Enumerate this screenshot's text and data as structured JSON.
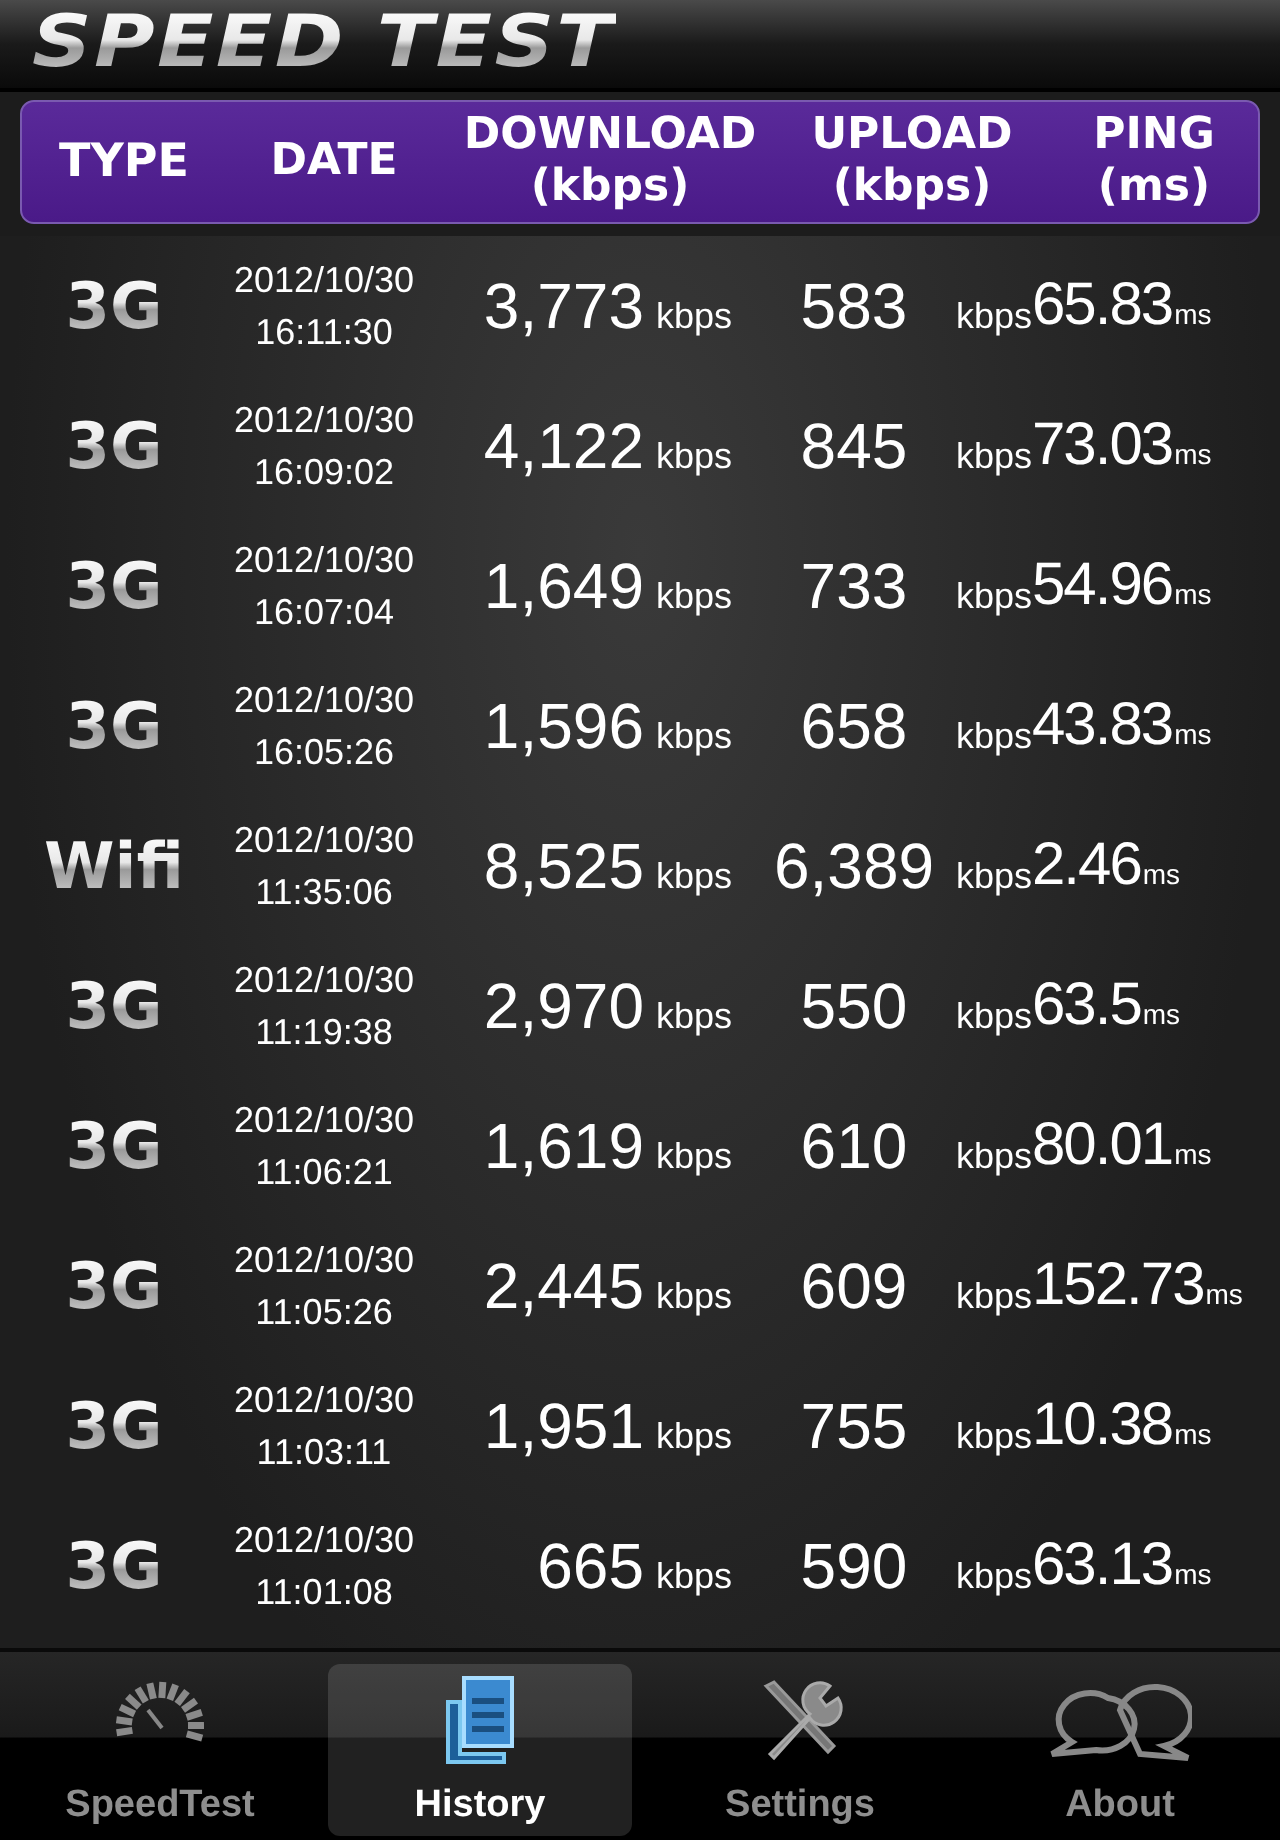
{
  "app": {
    "title": "SPEED TEST"
  },
  "columns": [
    {
      "label": "TYPE"
    },
    {
      "label": "DATE"
    },
    {
      "label": "DOWNLOAD",
      "unit": "(kbps)"
    },
    {
      "label": "UPLOAD",
      "unit": "(kbps)"
    },
    {
      "label": "PING",
      "unit": "(ms)"
    }
  ],
  "rows": [
    {
      "type": "3G",
      "date": "2012/10/30",
      "time": "16:11:30",
      "download": "3,773",
      "download_unit": "kbps",
      "upload": "583",
      "upload_unit": "kbps",
      "ping": "65.83",
      "ping_unit": "ms"
    },
    {
      "type": "3G",
      "date": "2012/10/30",
      "time": "16:09:02",
      "download": "4,122",
      "download_unit": "kbps",
      "upload": "845",
      "upload_unit": "kbps",
      "ping": "73.03",
      "ping_unit": "ms"
    },
    {
      "type": "3G",
      "date": "2012/10/30",
      "time": "16:07:04",
      "download": "1,649",
      "download_unit": "kbps",
      "upload": "733",
      "upload_unit": "kbps",
      "ping": "54.96",
      "ping_unit": "ms"
    },
    {
      "type": "3G",
      "date": "2012/10/30",
      "time": "16:05:26",
      "download": "1,596",
      "download_unit": "kbps",
      "upload": "658",
      "upload_unit": "kbps",
      "ping": "43.83",
      "ping_unit": "ms"
    },
    {
      "type": "Wifi",
      "date": "2012/10/30",
      "time": "11:35:06",
      "download": "8,525",
      "download_unit": "kbps",
      "upload": "6,389",
      "upload_unit": "kbps",
      "ping": "2.46",
      "ping_unit": "ms"
    },
    {
      "type": "3G",
      "date": "2012/10/30",
      "time": "11:19:38",
      "download": "2,970",
      "download_unit": "kbps",
      "upload": "550",
      "upload_unit": "kbps",
      "ping": "63.5",
      "ping_unit": "ms"
    },
    {
      "type": "3G",
      "date": "2012/10/30",
      "time": "11:06:21",
      "download": "1,619",
      "download_unit": "kbps",
      "upload": "610",
      "upload_unit": "kbps",
      "ping": "80.01",
      "ping_unit": "ms"
    },
    {
      "type": "3G",
      "date": "2012/10/30",
      "time": "11:05:26",
      "download": "2,445",
      "download_unit": "kbps",
      "upload": "609",
      "upload_unit": "kbps",
      "ping": "152.73",
      "ping_unit": "ms"
    },
    {
      "type": "3G",
      "date": "2012/10/30",
      "time": "11:03:11",
      "download": "1,951",
      "download_unit": "kbps",
      "upload": "755",
      "upload_unit": "kbps",
      "ping": "10.38",
      "ping_unit": "ms"
    },
    {
      "type": "3G",
      "date": "2012/10/30",
      "time": "11:01:08",
      "download": "665",
      "download_unit": "kbps",
      "upload": "590",
      "upload_unit": "kbps",
      "ping": "63.13",
      "ping_unit": "ms"
    }
  ],
  "tabs": [
    {
      "label": "SpeedTest",
      "selected": false
    },
    {
      "label": "History",
      "selected": true
    },
    {
      "label": "Settings",
      "selected": false
    },
    {
      "label": "About",
      "selected": false
    }
  ]
}
